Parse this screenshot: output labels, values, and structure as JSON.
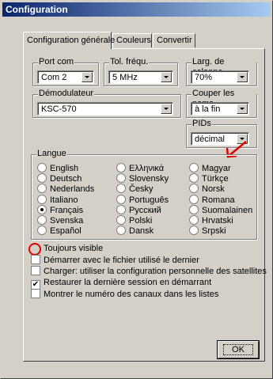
{
  "window": {
    "title": "Configuration"
  },
  "tabs": [
    "Configuration générale",
    "Couleurs",
    "Convertir"
  ],
  "groups": {
    "port": {
      "label": "Port com",
      "value": "Com 2"
    },
    "tol": {
      "label": "Tol. fréqu.",
      "value": "5 MHz"
    },
    "larg": {
      "label": "Larg. de colonne",
      "value": "70%"
    },
    "demod": {
      "label": "Démodulateur",
      "value": "KSC-570"
    },
    "couper": {
      "label": "Couper les noms",
      "value": "à la fin"
    },
    "pids": {
      "label": "PIDs",
      "value": "décimal"
    }
  },
  "langue": {
    "label": "Langue",
    "options": [
      "English",
      "Deutsch",
      "Nederlands",
      "Italiano",
      "Français",
      "Svenska",
      "Español",
      "Ελληνικά",
      "Slovensky",
      "Česky",
      "Português",
      "Русский",
      "Polski",
      "Dansk",
      "Magyar",
      "Türkçe",
      "Norsk",
      "Romana",
      "Suomalainen",
      "Hrvatski",
      "Srpski"
    ],
    "selected": "Français"
  },
  "options": [
    {
      "label": "Toujours visible",
      "checked": false
    },
    {
      "label": "Démarrer avec le fichier utilisé le dernier",
      "checked": false
    },
    {
      "label": "Charger: utiliser la configuration personnelle des satellites",
      "checked": false
    },
    {
      "label": "Restaurer la dernière session en démarrant",
      "checked": true
    },
    {
      "label": "Montrer le numéro des canaux dans les listes",
      "checked": false
    }
  ],
  "ok_label": "OK",
  "colors": {
    "annotation": "#e00000",
    "titlebar": "#0a246a"
  }
}
